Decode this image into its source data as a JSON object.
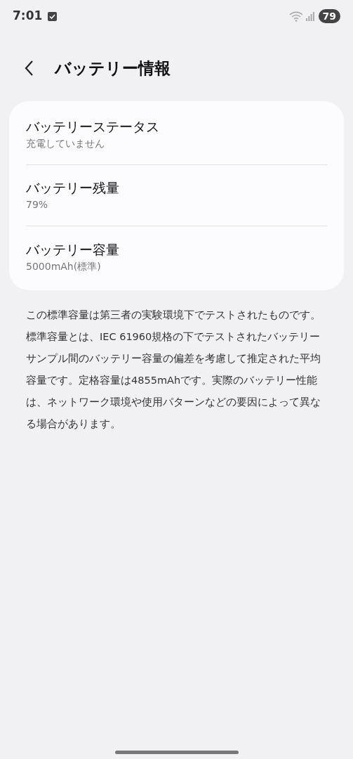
{
  "status_bar": {
    "time": "7:01",
    "battery": "79"
  },
  "header": {
    "title": "バッテリー情報"
  },
  "items": [
    {
      "title": "バッテリーステータス",
      "subtitle": "充電していません"
    },
    {
      "title": "バッテリー残量",
      "subtitle": "79%"
    },
    {
      "title": "バッテリー容量",
      "subtitle": "5000mAh(標準)"
    }
  ],
  "note": "この標準容量は第三者の実験環境下でテストされたものです。標準容量とは、IEC 61960規格の下でテストされたバッテリーサンプル間のバッテリー容量の偏差を考慮して推定された平均容量です。定格容量は4855mAhです。実際のバッテリー性能は、ネットワーク環境や使用パターンなどの要因によって異なる場合があります。"
}
